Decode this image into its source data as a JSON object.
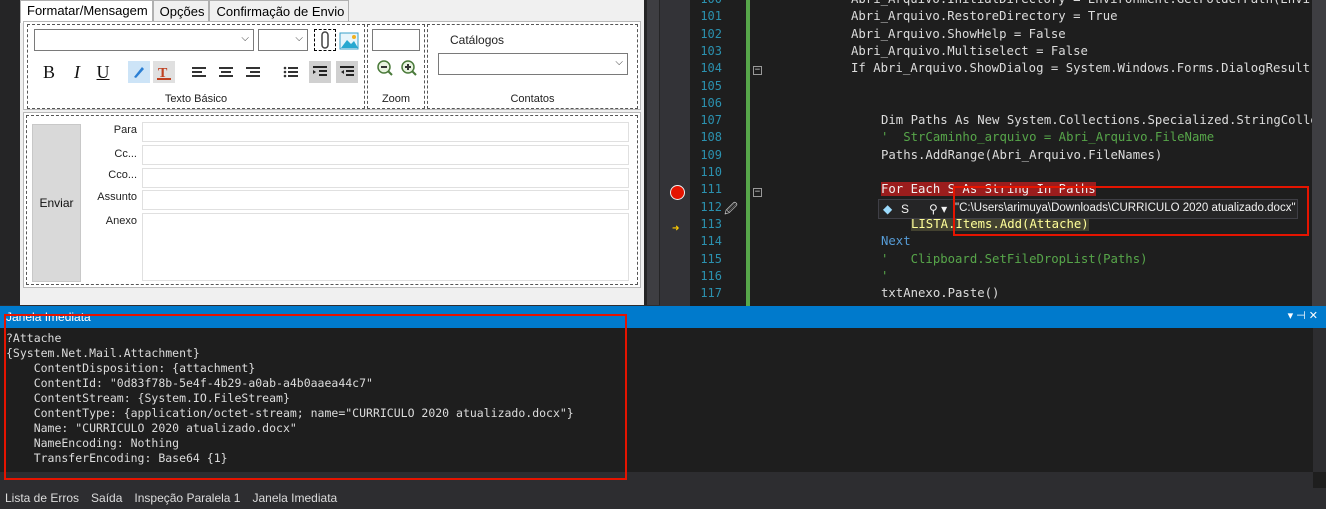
{
  "designer": {
    "tabs": [
      "Formatar/Mensagem",
      "Opções",
      "Confirmação de Envio"
    ],
    "groups": {
      "texto_basico": "Texto Básico",
      "zoom": "Zoom",
      "contatos": "Contatos"
    },
    "catalogos_label": "Catálogos",
    "format_buttons": {
      "bold": "B",
      "italic": "I",
      "underline": "U"
    },
    "send_button": "Enviar",
    "fields": [
      "Para",
      "Cc...",
      "Cco...",
      "Assunto",
      "Anexo"
    ]
  },
  "editor": {
    "lines": [
      {
        "n": "100",
        "text": "Abri_Arquivo.InitialDirectory = Environment.GetFolderPath(Envir"
      },
      {
        "n": "101",
        "text": "Abri_Arquivo.RestoreDirectory = True"
      },
      {
        "n": "102",
        "text": "Abri_Arquivo.ShowHelp = False"
      },
      {
        "n": "103",
        "text": "Abri_Arquivo.Multiselect = False"
      },
      {
        "n": "104",
        "text": "If Abri_Arquivo.ShowDialog = System.Windows.Forms.DialogResult."
      },
      {
        "n": "105",
        "text": ""
      },
      {
        "n": "106",
        "text": ""
      },
      {
        "n": "107",
        "text": "Dim Paths As New System.Collections.Specialized.StringColle"
      },
      {
        "n": "108",
        "text": "'  StrCaminho_arquivo = Abri_Arquivo.FileName"
      },
      {
        "n": "109",
        "text": "Paths.AddRange(Abri_Arquivo.FileNames)"
      },
      {
        "n": "110",
        "text": ""
      },
      {
        "n": "111",
        "text": "For Each S As String In Paths"
      },
      {
        "n": "112",
        "text": ""
      },
      {
        "n": "113",
        "text": "LISTA.Items.Add(Attache)"
      },
      {
        "n": "114",
        "text": "Next"
      },
      {
        "n": "115",
        "text": "'   Clipboard.SetFileDropList(Paths)"
      },
      {
        "n": "116",
        "text": "'"
      },
      {
        "n": "117",
        "text": "txtAnexo.Paste()"
      }
    ],
    "datatip": {
      "var": "S",
      "value": "\"C:\\Users\\arimuya\\Downloads\\CURRICULO 2020 atualizado.docx\""
    }
  },
  "immediate": {
    "title": "Janela Imediata",
    "lines": [
      "?Attache",
      "{System.Net.Mail.Attachment}",
      "    ContentDisposition: {attachment}",
      "    ContentId: \"0d83f78b-5e4f-4b29-a0ab-a4b0aaea44c7\"",
      "    ContentStream: {System.IO.FileStream}",
      "    ContentType: {application/octet-stream; name=\"CURRICULO 2020 atualizado.docx\"}",
      "    Name: \"CURRICULO 2020 atualizado.docx\"",
      "    NameEncoding: Nothing",
      "    TransferEncoding: Base64 {1}"
    ]
  },
  "bottom_tabs": [
    "Lista de Erros",
    "Saída",
    "Inspeção Paralela 1",
    "Janela Imediata"
  ]
}
